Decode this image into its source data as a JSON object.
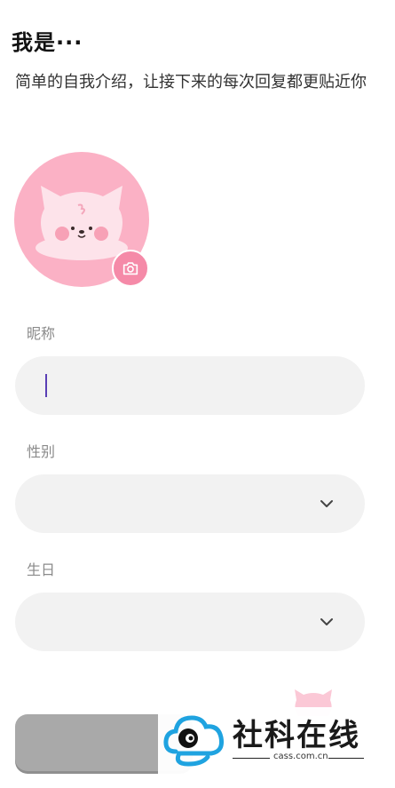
{
  "header": {
    "title": "我是···",
    "subtitle": "简单的自我介绍，让接下来的每次回复都更贴近你"
  },
  "avatar": {
    "bg_color": "#fbb1c5",
    "camera_icon": "camera-icon",
    "accent": "#f58aa8"
  },
  "form": {
    "nickname_label": "昵称",
    "nickname_value": "",
    "gender_label": "性别",
    "gender_value": "",
    "birthday_label": "生日",
    "birthday_value": "",
    "field_bg": "#f2f2f2",
    "chevron_icon": "chevron-down-icon"
  },
  "watermark": {
    "text": "社科在线",
    "url": "cass.com.cn"
  }
}
